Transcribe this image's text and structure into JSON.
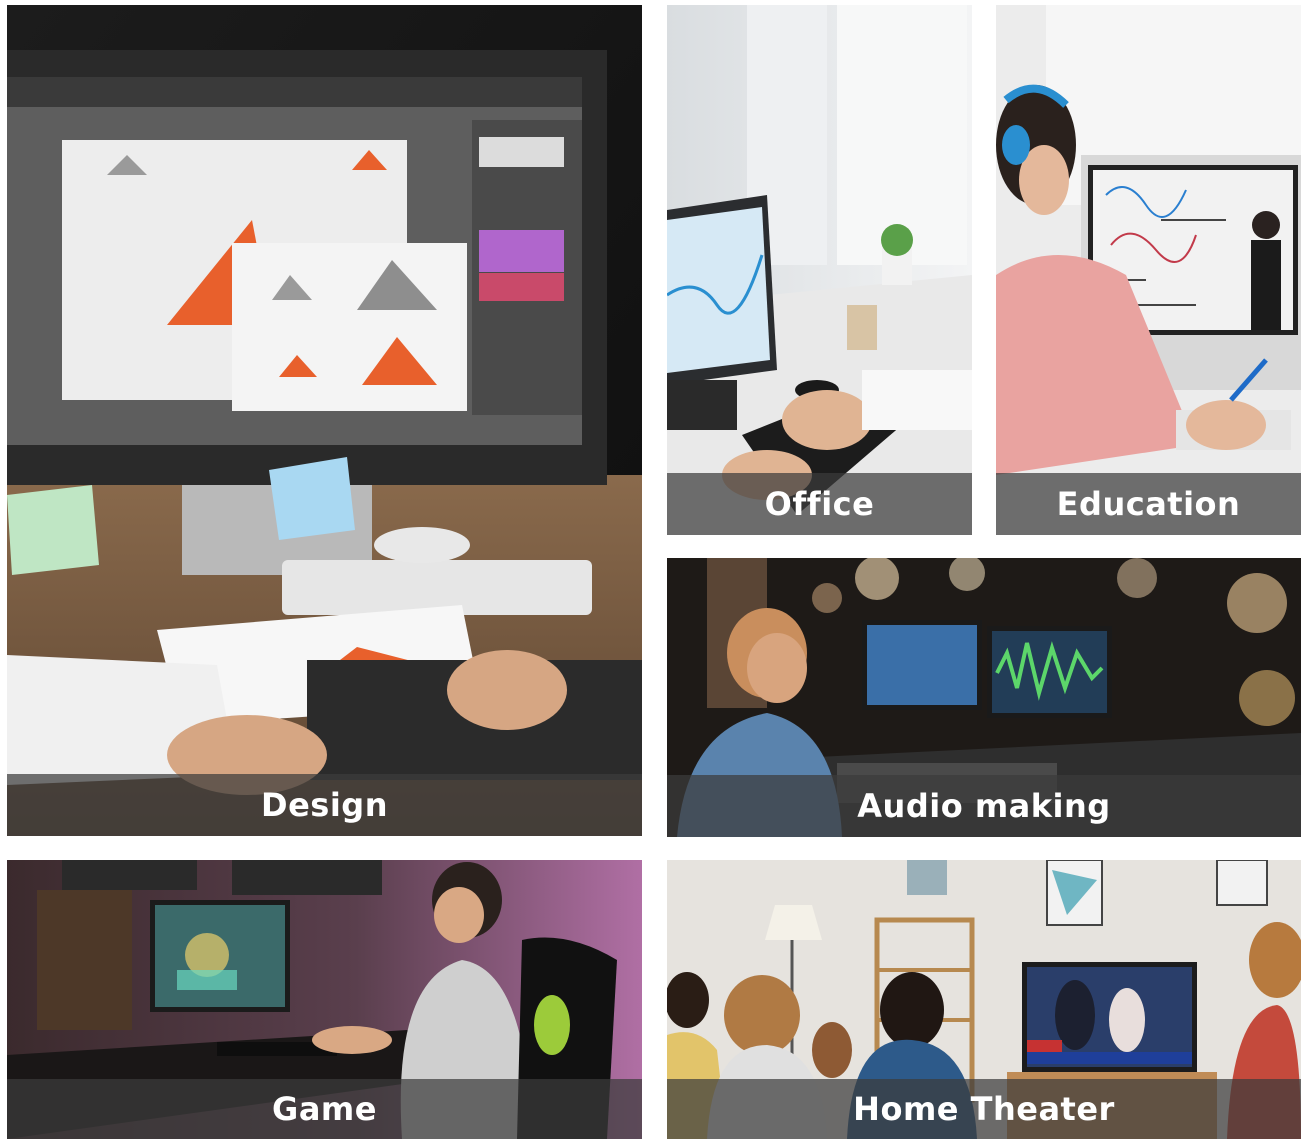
{
  "tiles": {
    "design": {
      "caption": "Design"
    },
    "office": {
      "caption": "Office"
    },
    "education": {
      "caption": "Education"
    },
    "audio": {
      "caption": "Audio making"
    },
    "game": {
      "caption": "Game"
    },
    "theater": {
      "caption": "Home Theater"
    }
  },
  "colors": {
    "caption_text": "#ffffff",
    "caption_bar": "#3c3c3c",
    "page_background": "#ffffff",
    "accent_orange": "#e8602c"
  }
}
